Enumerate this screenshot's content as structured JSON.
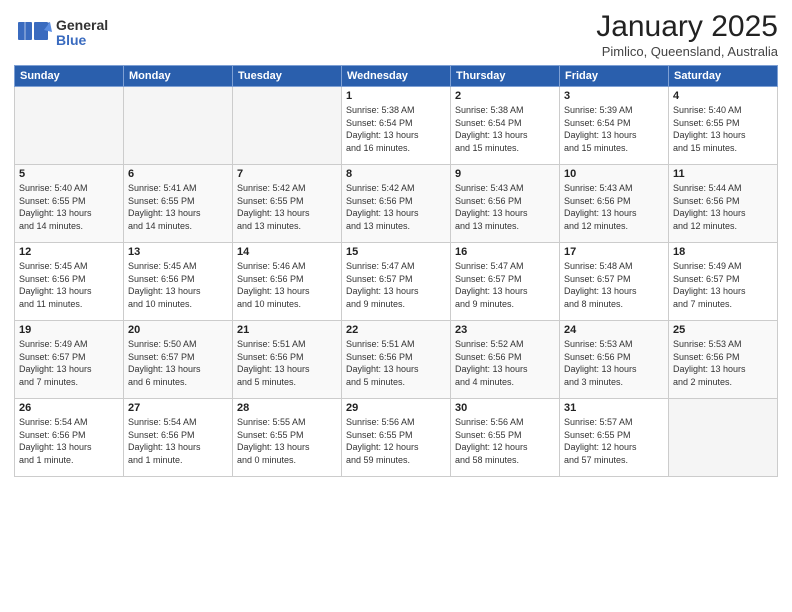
{
  "header": {
    "logo_general": "General",
    "logo_blue": "Blue",
    "month_title": "January 2025",
    "location": "Pimlico, Queensland, Australia"
  },
  "weekdays": [
    "Sunday",
    "Monday",
    "Tuesday",
    "Wednesday",
    "Thursday",
    "Friday",
    "Saturday"
  ],
  "weeks": [
    [
      {
        "day": "",
        "info": ""
      },
      {
        "day": "",
        "info": ""
      },
      {
        "day": "",
        "info": ""
      },
      {
        "day": "1",
        "info": "Sunrise: 5:38 AM\nSunset: 6:54 PM\nDaylight: 13 hours\nand 16 minutes."
      },
      {
        "day": "2",
        "info": "Sunrise: 5:38 AM\nSunset: 6:54 PM\nDaylight: 13 hours\nand 15 minutes."
      },
      {
        "day": "3",
        "info": "Sunrise: 5:39 AM\nSunset: 6:54 PM\nDaylight: 13 hours\nand 15 minutes."
      },
      {
        "day": "4",
        "info": "Sunrise: 5:40 AM\nSunset: 6:55 PM\nDaylight: 13 hours\nand 15 minutes."
      }
    ],
    [
      {
        "day": "5",
        "info": "Sunrise: 5:40 AM\nSunset: 6:55 PM\nDaylight: 13 hours\nand 14 minutes."
      },
      {
        "day": "6",
        "info": "Sunrise: 5:41 AM\nSunset: 6:55 PM\nDaylight: 13 hours\nand 14 minutes."
      },
      {
        "day": "7",
        "info": "Sunrise: 5:42 AM\nSunset: 6:55 PM\nDaylight: 13 hours\nand 13 minutes."
      },
      {
        "day": "8",
        "info": "Sunrise: 5:42 AM\nSunset: 6:56 PM\nDaylight: 13 hours\nand 13 minutes."
      },
      {
        "day": "9",
        "info": "Sunrise: 5:43 AM\nSunset: 6:56 PM\nDaylight: 13 hours\nand 13 minutes."
      },
      {
        "day": "10",
        "info": "Sunrise: 5:43 AM\nSunset: 6:56 PM\nDaylight: 13 hours\nand 12 minutes."
      },
      {
        "day": "11",
        "info": "Sunrise: 5:44 AM\nSunset: 6:56 PM\nDaylight: 13 hours\nand 12 minutes."
      }
    ],
    [
      {
        "day": "12",
        "info": "Sunrise: 5:45 AM\nSunset: 6:56 PM\nDaylight: 13 hours\nand 11 minutes."
      },
      {
        "day": "13",
        "info": "Sunrise: 5:45 AM\nSunset: 6:56 PM\nDaylight: 13 hours\nand 10 minutes."
      },
      {
        "day": "14",
        "info": "Sunrise: 5:46 AM\nSunset: 6:56 PM\nDaylight: 13 hours\nand 10 minutes."
      },
      {
        "day": "15",
        "info": "Sunrise: 5:47 AM\nSunset: 6:57 PM\nDaylight: 13 hours\nand 9 minutes."
      },
      {
        "day": "16",
        "info": "Sunrise: 5:47 AM\nSunset: 6:57 PM\nDaylight: 13 hours\nand 9 minutes."
      },
      {
        "day": "17",
        "info": "Sunrise: 5:48 AM\nSunset: 6:57 PM\nDaylight: 13 hours\nand 8 minutes."
      },
      {
        "day": "18",
        "info": "Sunrise: 5:49 AM\nSunset: 6:57 PM\nDaylight: 13 hours\nand 7 minutes."
      }
    ],
    [
      {
        "day": "19",
        "info": "Sunrise: 5:49 AM\nSunset: 6:57 PM\nDaylight: 13 hours\nand 7 minutes."
      },
      {
        "day": "20",
        "info": "Sunrise: 5:50 AM\nSunset: 6:57 PM\nDaylight: 13 hours\nand 6 minutes."
      },
      {
        "day": "21",
        "info": "Sunrise: 5:51 AM\nSunset: 6:56 PM\nDaylight: 13 hours\nand 5 minutes."
      },
      {
        "day": "22",
        "info": "Sunrise: 5:51 AM\nSunset: 6:56 PM\nDaylight: 13 hours\nand 5 minutes."
      },
      {
        "day": "23",
        "info": "Sunrise: 5:52 AM\nSunset: 6:56 PM\nDaylight: 13 hours\nand 4 minutes."
      },
      {
        "day": "24",
        "info": "Sunrise: 5:53 AM\nSunset: 6:56 PM\nDaylight: 13 hours\nand 3 minutes."
      },
      {
        "day": "25",
        "info": "Sunrise: 5:53 AM\nSunset: 6:56 PM\nDaylight: 13 hours\nand 2 minutes."
      }
    ],
    [
      {
        "day": "26",
        "info": "Sunrise: 5:54 AM\nSunset: 6:56 PM\nDaylight: 13 hours\nand 1 minute."
      },
      {
        "day": "27",
        "info": "Sunrise: 5:54 AM\nSunset: 6:56 PM\nDaylight: 13 hours\nand 1 minute."
      },
      {
        "day": "28",
        "info": "Sunrise: 5:55 AM\nSunset: 6:55 PM\nDaylight: 13 hours\nand 0 minutes."
      },
      {
        "day": "29",
        "info": "Sunrise: 5:56 AM\nSunset: 6:55 PM\nDaylight: 12 hours\nand 59 minutes."
      },
      {
        "day": "30",
        "info": "Sunrise: 5:56 AM\nSunset: 6:55 PM\nDaylight: 12 hours\nand 58 minutes."
      },
      {
        "day": "31",
        "info": "Sunrise: 5:57 AM\nSunset: 6:55 PM\nDaylight: 12 hours\nand 57 minutes."
      },
      {
        "day": "",
        "info": ""
      }
    ]
  ]
}
